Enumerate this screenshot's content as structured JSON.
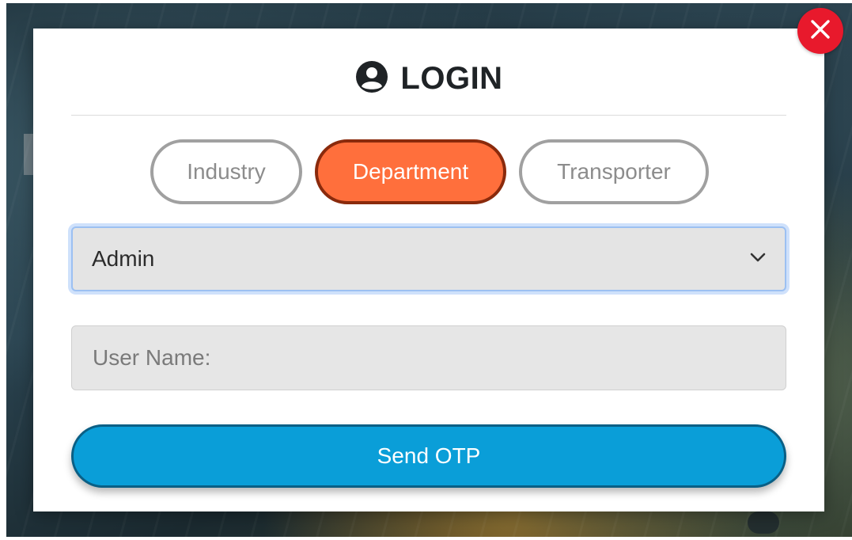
{
  "modal": {
    "title": "LOGIN",
    "title_icon": "user-circle-icon",
    "close_icon": "close-icon"
  },
  "tabs": [
    {
      "label": "Industry",
      "active": false
    },
    {
      "label": "Department",
      "active": true
    },
    {
      "label": "Transporter",
      "active": false
    }
  ],
  "role_select": {
    "value": "Admin",
    "icon": "chevron-down-icon"
  },
  "username_field": {
    "placeholder": "User Name:",
    "value": ""
  },
  "send_otp": {
    "label": "Send OTP"
  },
  "colors": {
    "accent_active_tab": "#ff6f3c",
    "primary_button": "#0a9ed8",
    "close_button": "#e8192c"
  }
}
